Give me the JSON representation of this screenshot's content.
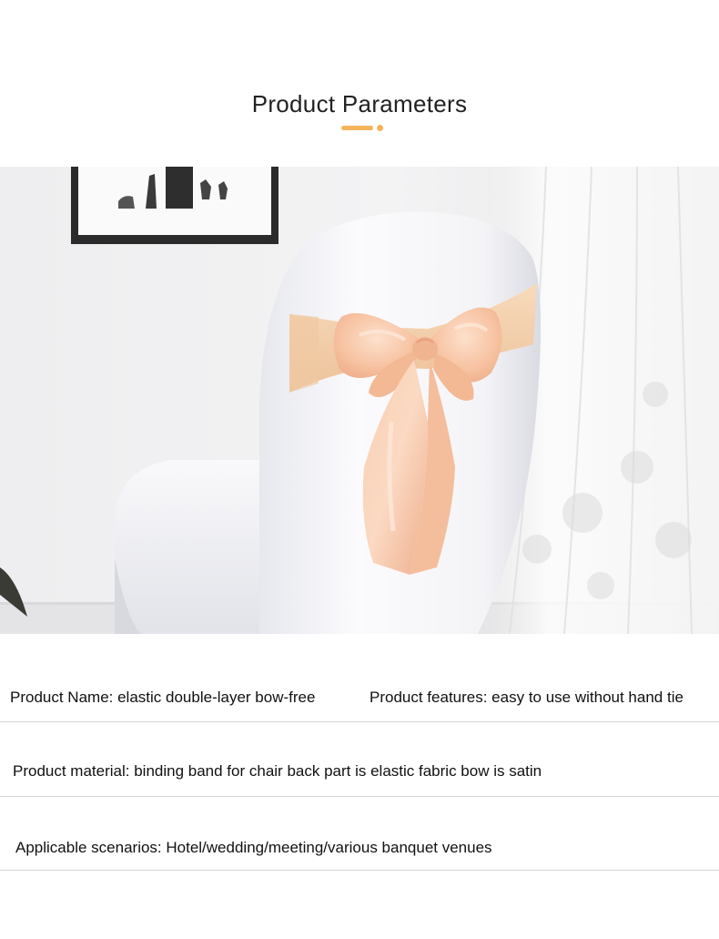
{
  "header": {
    "title": "Product Parameters",
    "accent_color": "#f5b45b"
  },
  "photo": {
    "description_icon": "chair-with-peach-bow-image",
    "bow_color": "#f7c7a8",
    "band_color": "#f3cfae",
    "chair_color": "#f7f7f9"
  },
  "parameters": {
    "product_name": "Product Name: elastic double-layer bow-free",
    "product_features": "Product features: easy to use without hand tie",
    "product_material": "Product material: binding band for chair back part is elastic fabric bow is satin",
    "applicable_scenarios": "Applicable scenarios: Hotel/wedding/meeting/various banquet venues"
  }
}
